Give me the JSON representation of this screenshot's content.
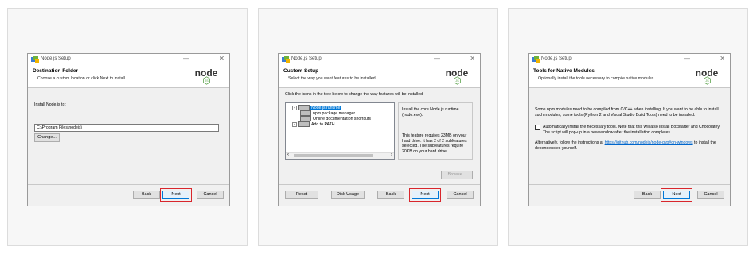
{
  "window_title": "Node.js Setup",
  "logo_text": "node",
  "buttons": {
    "back": "Back",
    "next": "Next",
    "cancel": "Cancel",
    "reset": "Reset",
    "disk_usage": "Disk Usage",
    "change": "Change...",
    "browse": "Browse..."
  },
  "screen1": {
    "title": "Destination Folder",
    "subtitle": "Choose a custom location or click Next to install.",
    "install_label": "Install Node.js to:",
    "path_value": "C:\\Program Files\\nodejs\\"
  },
  "screen2": {
    "title": "Custom Setup",
    "subtitle": "Select the way you want features to be installed.",
    "instruction": "Click the icons in the tree below to change the way features will be installed.",
    "features": [
      "Node.js runtime",
      "npm package manager",
      "Online documentation shortcuts",
      "Add to PATH"
    ],
    "desc1": "Install the core Node.js runtime (node.exe).",
    "desc2": "This feature requires 23MB on your hard drive. It has 2 of 2 subfeatures selected. The subfeatures require 20KB on your hard drive."
  },
  "screen3": {
    "title": "Tools for Native Modules",
    "subtitle": "Optionally install the tools necessary to compile native modules.",
    "para1": "Some npm modules need to be compiled from C/C++ when installing. If you want to be able to install such modules, some tools (Python 2 and Visual Studio Build Tools) need to be installed.",
    "checkbox_label": "Automatically install the necessary tools. Note that this will also install Boxstarter and Chocolatey. The script will pop-up in a new window after the installation completes.",
    "checkbox_checked": false,
    "alt_prefix": "Alternatively, follow the instructions at ",
    "alt_link": "https://github.com/nodejs/node-gyp#on-windows",
    "alt_suffix": " to install the dependencies yourself."
  },
  "colors": {
    "highlight": "#d9262c",
    "node_green": "#539e43",
    "selection": "#0078d7"
  }
}
